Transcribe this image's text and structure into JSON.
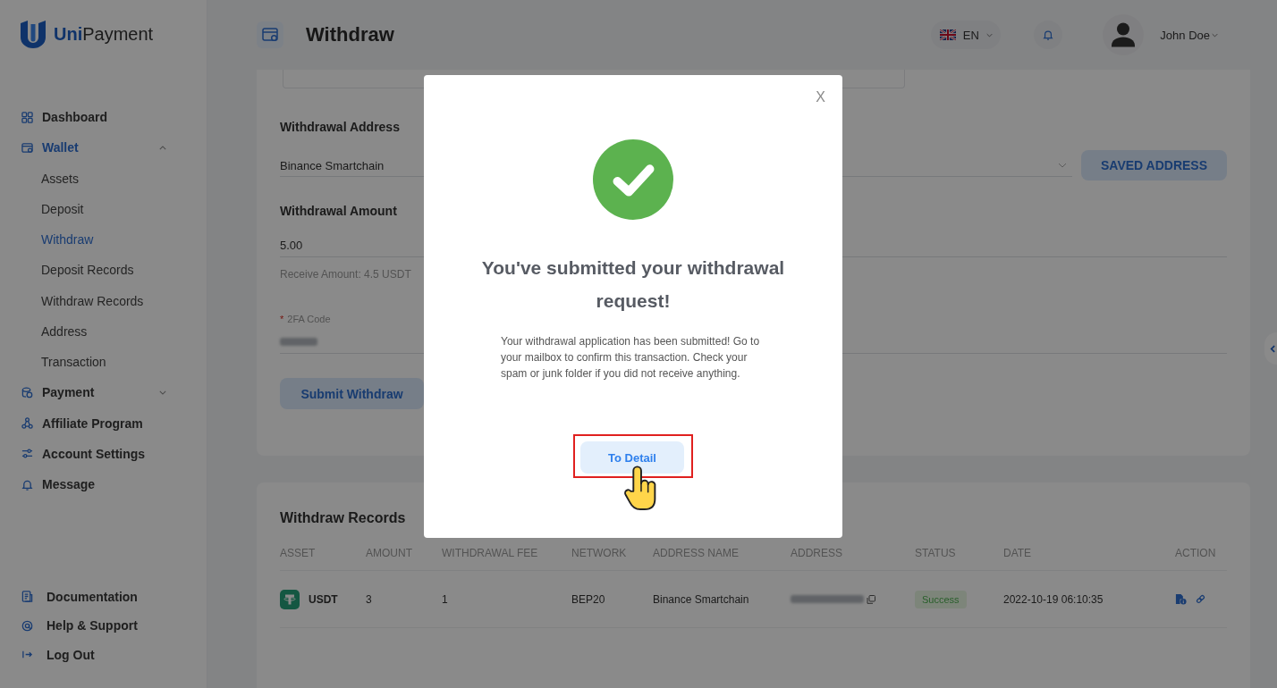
{
  "sidebar": {
    "logo": "**Uni**Payment",
    "nav": [
      {
        "label": "Dashboard",
        "kind": "link",
        "selected": false
      },
      {
        "label": "Wallet",
        "kind": "group",
        "selected": true,
        "expanded": true,
        "children": [
          {
            "label": "Assets",
            "selected": false
          },
          {
            "label": "Deposit",
            "selected": false
          },
          {
            "label": "Withdraw",
            "selected": true
          },
          {
            "label": "Deposit Records",
            "selected": false
          },
          {
            "label": "Withdraw Records",
            "selected": false
          },
          {
            "label": "Address",
            "selected": false
          },
          {
            "label": "Transaction",
            "selected": false
          }
        ]
      },
      {
        "label": "Payment",
        "kind": "group",
        "selected": false,
        "expanded": false
      },
      {
        "label": "Affiliate Program",
        "kind": "link",
        "selected": false
      },
      {
        "label": "Account Settings",
        "kind": "link",
        "selected": false
      },
      {
        "label": "Message",
        "kind": "link",
        "selected": false
      }
    ],
    "footer": [
      {
        "label": "Documentation"
      },
      {
        "label": "Help & Support"
      },
      {
        "label": "Log Out"
      }
    ]
  },
  "header": {
    "title": "Withdraw",
    "language": "EN",
    "user": "John Doe"
  },
  "form": {
    "address": {
      "label": "Withdrawal Address",
      "value": "Binance Smartchain",
      "button": "SAVED ADDRESS"
    },
    "amount": {
      "label": "Withdrawal Amount",
      "value": "5.00",
      "hint": "Receive Amount: 4.5 USDT"
    },
    "code": {
      "required_mark": "*",
      "label": "2FA Code"
    },
    "submit": "Submit Withdraw"
  },
  "records": {
    "title": "Withdraw Records",
    "columns": [
      "ASSET",
      "AMOUNT",
      "WITHDRAWAL FEE",
      "NETWORK",
      "ADDRESS NAME",
      "ADDRESS",
      "STATUS",
      "DATE",
      "ACTION"
    ],
    "rows": [
      {
        "asset": "USDT",
        "amount": "3",
        "fee": "1",
        "network": "BEP20",
        "address_name": "Binance Smartchain",
        "status": "Success",
        "date": "2022-10-19 06:10:35"
      }
    ]
  },
  "modal": {
    "close": "X",
    "title": "You've submitted your withdrawal request!",
    "message": "Your withdrawal application has been submitted! Go to your mailbox to confirm this transaction. Check your spam or junk folder if you did not receive anything.",
    "button": "To Detail"
  }
}
